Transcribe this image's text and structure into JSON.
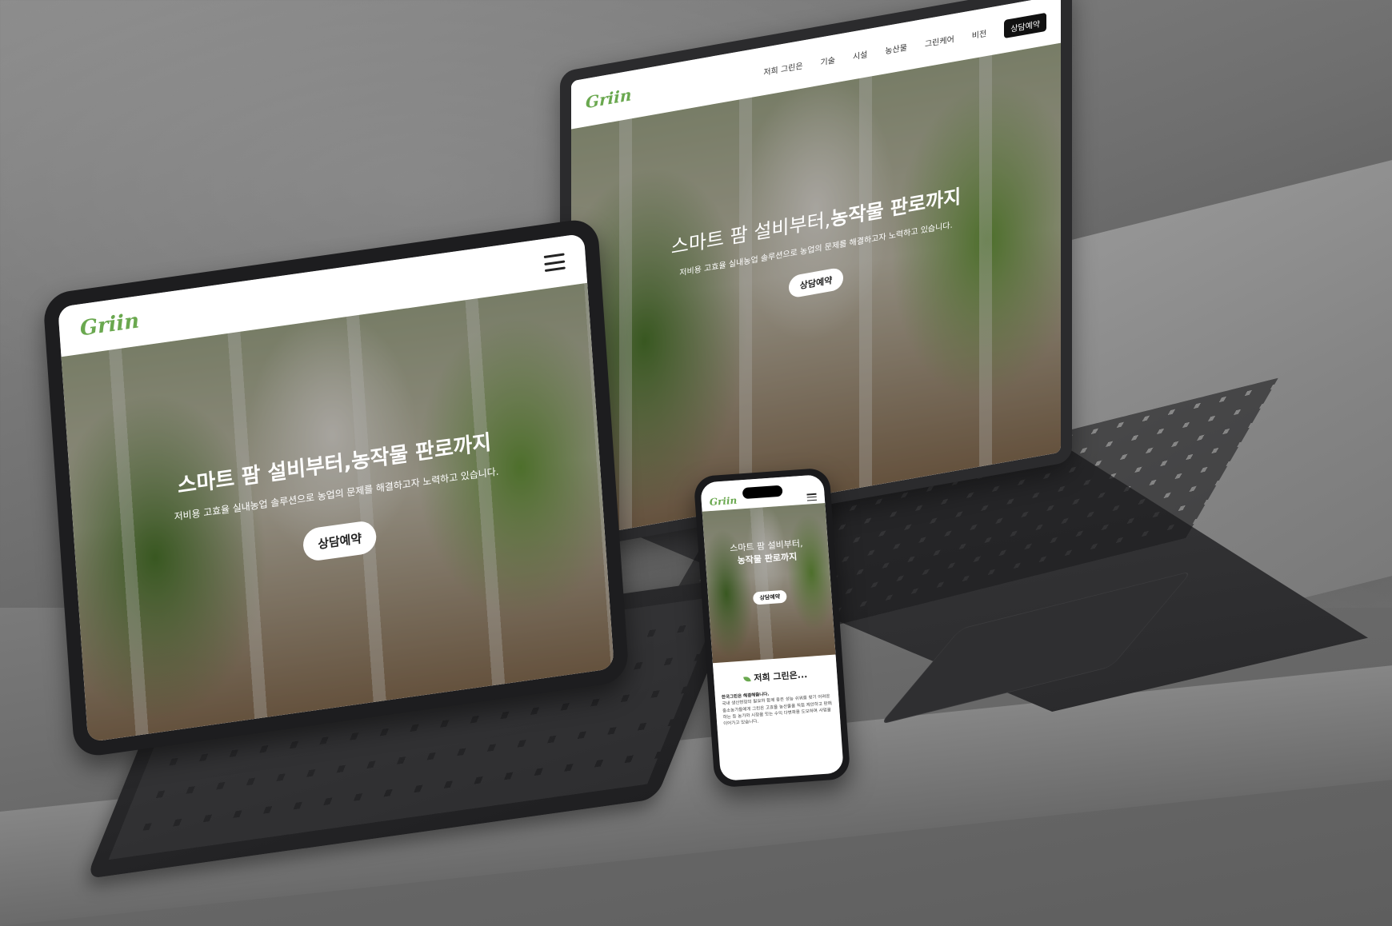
{
  "brand": {
    "logo_text": "Griin",
    "accent_color": "#6aa84f"
  },
  "laptop": {
    "nav": [
      "저희 그린은",
      "기술",
      "시설",
      "농산물",
      "그린케어",
      "비전"
    ],
    "nav_cta": "상담예약",
    "hero_title_light": "스마트 팜 설비부터,",
    "hero_title_bold": "농작물 판로까지",
    "hero_subtitle": "저비용 고효율 실내농업 솔루션으로 농업의 문제를 해결하고자 노력하고 있습니다.",
    "hero_button": "상담예약"
  },
  "tablet": {
    "hero_title": "스마트 팜 설비부터,농작물 판로까지",
    "hero_subtitle": "저비용 고효율 실내농업 솔루션으로 농업의 문제를 해결하고자 노력하고 있습니다.",
    "hero_button": "상담예약",
    "menu_icon": "hamburger-icon"
  },
  "phone": {
    "hero_line1": "스마트 팜 설비부터,",
    "hero_line2": "농작물 판로까지",
    "hero_button": "상담예약",
    "about_title": "저희 그린은...",
    "about_lead": "한국그린은 해결해줍니다.",
    "about_body": "국내 생산현장의 필요와 함께 좋은 성능 쉬워를 찾기 어려운 중소농가들에게 그린은 고효율 농산물을 직접 제안하고 판매하는 등 농가와 시장을 잇는 수익 다변화를 도모하며 사업을 이어가고 있습니다."
  }
}
